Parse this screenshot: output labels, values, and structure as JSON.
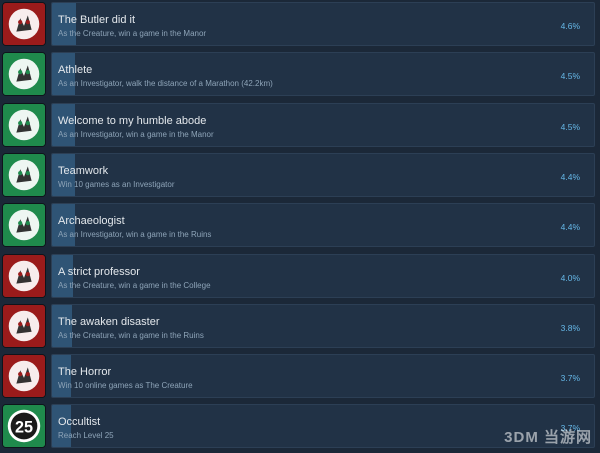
{
  "watermark": "3DM 当游网",
  "achievements": [
    {
      "title": "The Butler did it",
      "desc": "As the Creature, win a game in the Manor",
      "pct": "4.6%",
      "pct_value": 4.6,
      "icon": "creature-claw-icon",
      "color": "#9a1b1b"
    },
    {
      "title": "Athlete",
      "desc": "As an Investigator, walk the distance of a Marathon (42.2km)",
      "pct": "4.5%",
      "pct_value": 4.5,
      "icon": "runner-icon",
      "color": "#1f8a4c"
    },
    {
      "title": "Welcome to my humble abode",
      "desc": "As an Investigator, win a game in the Manor",
      "pct": "4.5%",
      "pct_value": 4.5,
      "icon": "investigator-claw-icon",
      "color": "#1f8a4c"
    },
    {
      "title": "Teamwork",
      "desc": "Win 10 games as an Investigator",
      "pct": "4.4%",
      "pct_value": 4.4,
      "icon": "investigator-portrait-icon",
      "color": "#1f8a4c"
    },
    {
      "title": "Archaeologist",
      "desc": "As an Investigator, win a game in the Ruins",
      "pct": "4.4%",
      "pct_value": 4.4,
      "icon": "ruins-skull-icon",
      "color": "#1f8a4c"
    },
    {
      "title": "A strict professor",
      "desc": "As the Creature, win a game in the College",
      "pct": "4.0%",
      "pct_value": 4.0,
      "icon": "graduation-cap-icon",
      "color": "#9a1b1b"
    },
    {
      "title": "The awaken disaster",
      "desc": "As the Creature, win a game in the Ruins",
      "pct": "3.8%",
      "pct_value": 3.8,
      "icon": "disaster-skull-icon",
      "color": "#9a1b1b"
    },
    {
      "title": "The Horror",
      "desc": "Win 10 online games as The Creature",
      "pct": "3.7%",
      "pct_value": 3.7,
      "icon": "horror-face-icon",
      "color": "#9a1b1b"
    },
    {
      "title": "Occultist",
      "desc": "Reach Level 25",
      "pct": "3.7%",
      "pct_value": 3.7,
      "icon": "level-25-badge-icon",
      "color": "#1f8a4c",
      "badge_text": "25"
    }
  ]
}
